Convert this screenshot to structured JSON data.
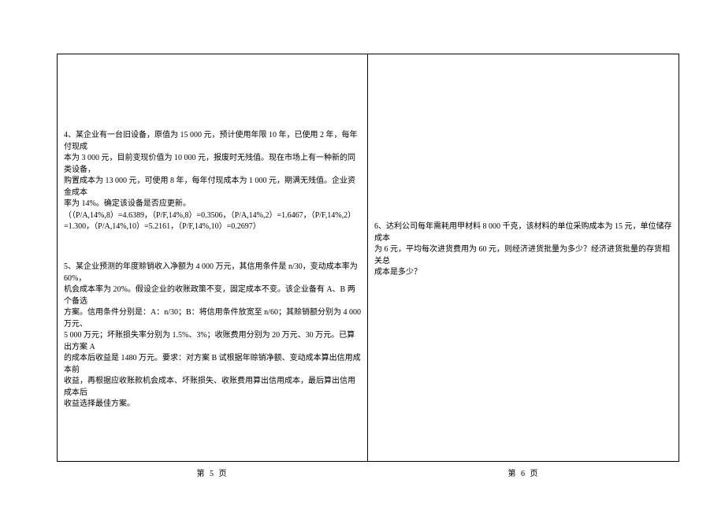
{
  "left": {
    "q4": {
      "line1": "4、某企业有一台旧设备，原值为 15 000 元，预计使用年限 10 年，已使用 2 年，每年付现成",
      "line2": "本为 3 000 元，目前变现价值为 10 000 元，报废时无残值。现在市场上有一种新的同类设备，",
      "line3": "购置成本为 13 000 元，可使用 8 年，每年付现成本为 1 000 元，期满无残值。企业资金成本",
      "line4": "率为 14%。确定该设备是否应更新。",
      "line5": "（（P/A,14%,8）=4.6389，（P/F,14%,8）=0.3506，（P/A,14%,2）=1.6467，（P/F,14%,2）",
      "line6": "=1.300，（P/A,14%,10）=5.2161，（P/F,14%,10）=0.2697）"
    },
    "q5": {
      "line1": "5、某企业预测的年度赊销收入净额为 4 000 万元，其信用条件是 n/30，变动成本率为 60%，",
      "line2": "机会成本率为 20%。假设企业的收账政策不变，固定成本不变。该企业备有 A、B 两个备选",
      "line3": "方案。信用条件分别是：A：n/30；B：将信用条件放宽至 n/60；其赊销额分别为 4 000 万元、",
      "line4": "5 000 万元；坏账损失率分别为 1.5%、3%；收账费用分别为 20 万元、30 万元。已算出方案 A",
      "line5": "的成本后收益是 1480 万元。要求：对方案 B 试根据年赊销净额、变动成本算出信用成本前",
      "line6": "收益，再根据应收账款机会成本、坏账损失、收账费用算出信用成本，最后算出信用成本后",
      "line7": "收益选择最佳方案。"
    }
  },
  "right": {
    "q6": {
      "line1": "6、达利公司每年需耗用甲材料 8 000 千克，该材料的单位采购成本为 15 元，单位储存成本",
      "line2": "为 6 元，平均每次进货费用为 60 元，则经济进货批量为多少？经济进货批量的存货相关总",
      "line3": "成本是多少？"
    }
  },
  "footer": {
    "left": "第  5  页",
    "right": "第  6  页"
  }
}
